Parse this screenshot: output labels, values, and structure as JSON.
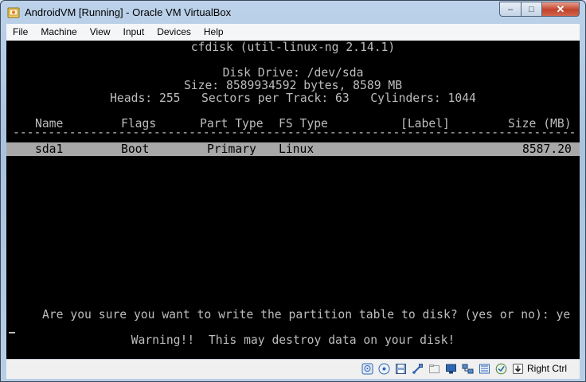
{
  "window": {
    "title": "AndroidVM [Running] - Oracle VM VirtualBox",
    "minimize_glyph": "–",
    "maximize_glyph": "□",
    "close_glyph": "✕"
  },
  "menubar": {
    "items": [
      "File",
      "Machine",
      "View",
      "Input",
      "Devices",
      "Help"
    ]
  },
  "console": {
    "program": "cfdisk (util-linux-ng 2.14.1)",
    "disk_drive": "Disk Drive: /dev/sda",
    "size_line": "Size: 8589934592 bytes, 8589 MB",
    "geometry_line": "Heads: 255   Sectors per Track: 63   Cylinders: 1044",
    "table": {
      "headers": {
        "name": "Name",
        "flags": "Flags",
        "part_type": "Part Type",
        "fs_type": "FS Type",
        "label": "[Label]",
        "size": "Size (MB)"
      },
      "rows": [
        {
          "name": "sda1",
          "flags": "Boot",
          "part_type": "Primary",
          "fs_type": "Linux",
          "label": "",
          "size": "8587.20"
        }
      ]
    },
    "prompt": "Are you sure you want to write the partition table to disk? (yes or no): ye",
    "warning": "Warning!!  This may destroy data on your disk!"
  },
  "statusbar": {
    "host_key_label": "Right Ctrl",
    "icons": [
      "hard-disk-icon",
      "optical-drive-icon",
      "floppy-icon",
      "usb-icon",
      "shared-folder-icon",
      "display-icon",
      "network-icon",
      "video-capture-icon",
      "mouse-integration-icon",
      "keyboard-capture-icon"
    ]
  }
}
